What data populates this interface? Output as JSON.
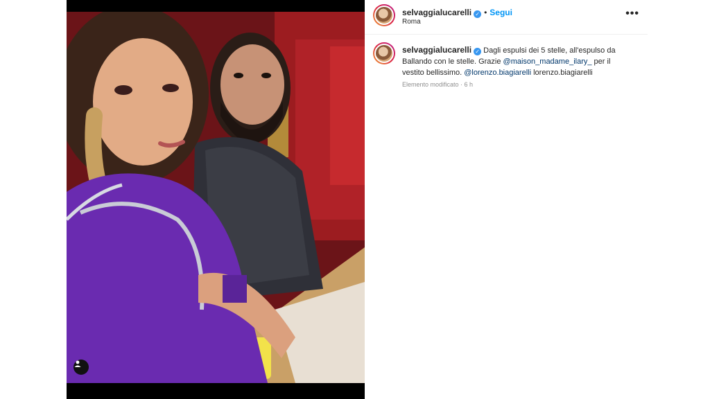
{
  "post": {
    "username": "selvaggialucarelli",
    "follow_label": "Segui",
    "separator": "•",
    "location": "Roma",
    "more_label": "•••",
    "verified_glyph": "✓"
  },
  "caption": {
    "username": "selvaggialucarelli",
    "text_1": "Dagli espulsi dei 5 stelle, all'espulso da Ballando con le stelle. Grazie ",
    "mention_1": "@maison_madame_ilary_",
    "text_2": " per il vestito bellissimo. ",
    "mention_2": "@lorenzo.biagiarelli",
    "text_3": " lorenzo.biagiarelli",
    "meta": "Elemento modificato · 6 h"
  },
  "icons": {
    "tag": "person-tag-icon",
    "verified": "verified-badge-icon",
    "more": "more-options-icon"
  },
  "colors": {
    "accent": "#0095f6",
    "link": "#00376b",
    "muted": "#8e8e8e",
    "verified": "#3897f0"
  }
}
